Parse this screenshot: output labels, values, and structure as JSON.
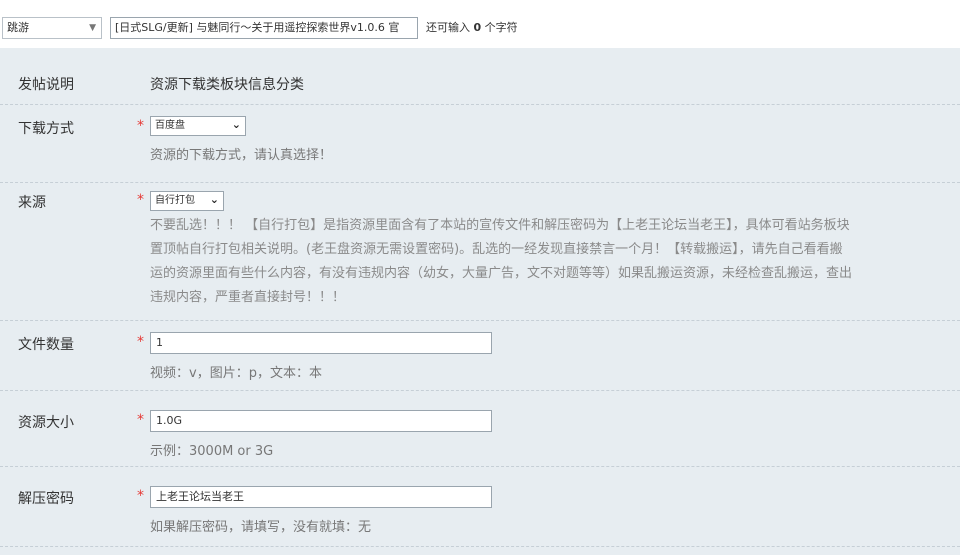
{
  "header": {
    "category_value": "跳游",
    "title_value": "[日式SLG/更新] 与魅同行～关于用遥控探索世界v1.0.6 官",
    "counter_prefix": "还可输入",
    "counter_count": "0",
    "counter_suffix": "个字符"
  },
  "form": {
    "post_note": {
      "label": "发帖说明",
      "value": "资源下载类板块信息分类"
    },
    "download_method": {
      "label": "下载方式",
      "required": "*",
      "selected": "百度盘",
      "hint": "资源的下载方式，请认真选择！"
    },
    "source": {
      "label": "来源",
      "required": "*",
      "selected": "自行打包",
      "hint_lines": [
        "不要乱选！！！ 【自行打包】是指资源里面含有了本站的宣传文件和解压密码为【上老王论坛当老王】，具体可看站务板块",
        "置顶帖自行打包相关说明。(老王盘资源无需设置密码)。乱选的一经发现直接禁言一个月！【转载搬运】，请先自己看看搬",
        "运的资源里面有些什么内容，有没有违规内容（幼女，大量广告，文不对题等等）如果乱搬运资源，未经检查乱搬运，查出",
        "违规内容，严重者直接封号！！！"
      ]
    },
    "file_count": {
      "label": "文件数量",
      "required": "*",
      "value": "1",
      "hint": "视频：v，图片：p，文本：本"
    },
    "size": {
      "label": "资源大小",
      "required": "*",
      "value": "1.0G",
      "hint": "示例：3000M or 3G"
    },
    "password": {
      "label": "解压密码",
      "required": "*",
      "value": "上老王论坛当老王",
      "hint": "如果解压密码，请填写，没有就填：无"
    }
  }
}
